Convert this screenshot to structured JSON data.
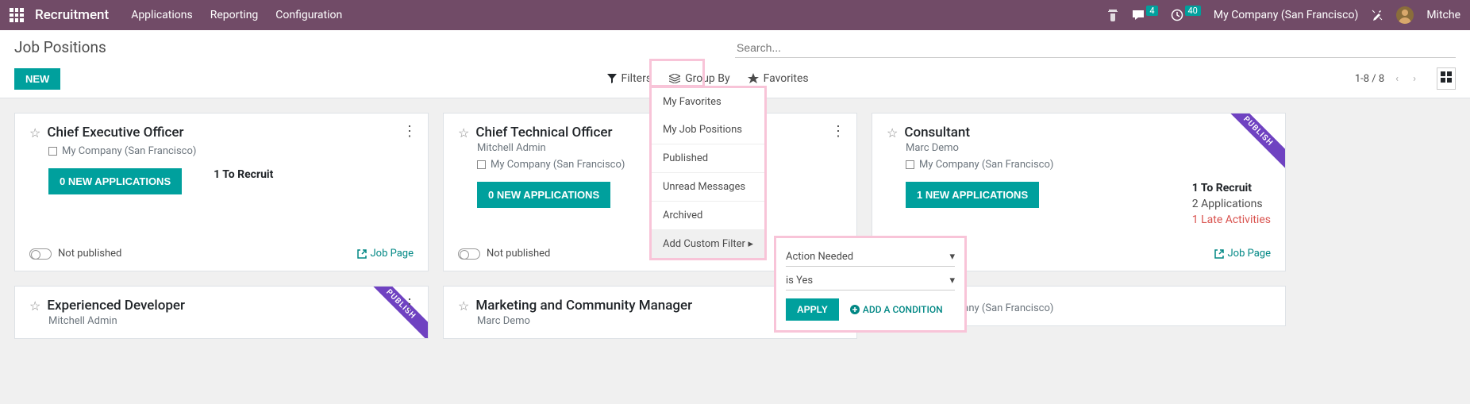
{
  "topbar": {
    "brand": "Recruitment",
    "nav": [
      "Applications",
      "Reporting",
      "Configuration"
    ],
    "badges": {
      "chat": "4",
      "clock": "40"
    },
    "company": "My Company (San Francisco)",
    "user": "Mitche"
  },
  "controlPanel": {
    "title": "Job Positions",
    "newBtn": "NEW",
    "searchPlaceholder": "Search...",
    "filters": "Filters",
    "groupBy": "Group By",
    "favorites": "Favorites",
    "pager": "1-8 / 8"
  },
  "filterMenu": {
    "items": [
      "My Favorites",
      "My Job Positions",
      "Published",
      "Unread Messages",
      "Archived"
    ],
    "addCustom": "Add Custom Filter"
  },
  "customFilter": {
    "field": "Action Needed",
    "condition": "is Yes",
    "apply": "APPLY",
    "addCondition": "ADD A CONDITION"
  },
  "cards": [
    {
      "title": "Chief Executive Officer",
      "company": "My Company (San Francisco)",
      "appBtn": "0 NEW APPLICATIONS",
      "recruit": "1 To Recruit",
      "pubText": "Not published",
      "jobPage": "Job Page"
    },
    {
      "title": "Chief Technical Officer",
      "subtitle": "Mitchell Admin",
      "company": "My Company (San Francisco)",
      "appBtn": "0 NEW APPLICATIONS",
      "pubText": "Not published"
    },
    {
      "title": "Consultant",
      "subtitle": "Marc Demo",
      "company": "My Company (San Francisco)",
      "appBtn": "1 NEW APPLICATIONS",
      "recruit": "1 To Recruit",
      "apps": "2 Applications",
      "late": "1 Late Activities",
      "jobPage": "Job Page",
      "ribbon": "PUBLISH"
    },
    {
      "title": "Experienced Developer",
      "subtitle": "Mitchell Admin",
      "ribbon": "PUBLISH"
    },
    {
      "title": "Marketing and Community Manager",
      "subtitle": "Marc Demo"
    },
    {
      "company": "My Company (San Francisco)"
    }
  ]
}
